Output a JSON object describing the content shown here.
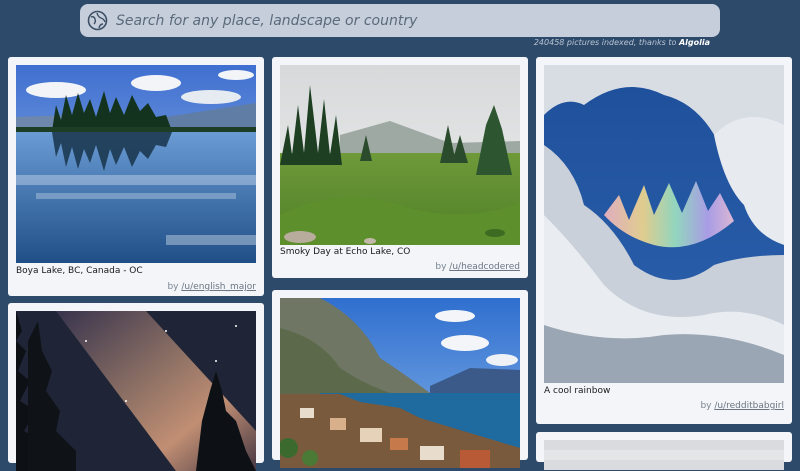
{
  "search": {
    "placeholder": "Search for any place, landscape or country",
    "index_count": "240458 pictures indexed, thanks to",
    "index_source": "Algolia"
  },
  "cards": [
    {
      "caption": "Boya Lake, BC, Canada - OC",
      "by": "by",
      "author": "/u/english_major"
    },
    {
      "caption": "Smoky Day at Echo Lake, CO",
      "by": "by",
      "author": "/u/headcodered"
    },
    {
      "caption": "A cool rainbow",
      "by": "by",
      "author": "/u/redditbabgirl"
    }
  ],
  "colors": {
    "background": "#2d4a6b",
    "card": "#f3f5f8",
    "search": "#c5ceda"
  }
}
